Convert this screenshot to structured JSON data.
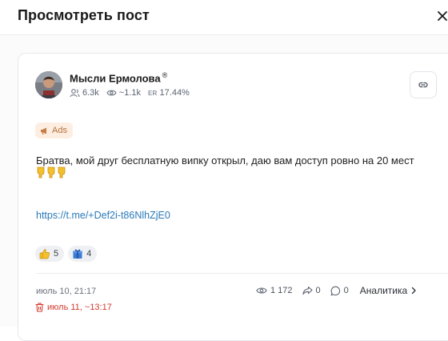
{
  "header": {
    "title": "Просмотреть пост"
  },
  "channel": {
    "name": "Мысли Ермолова",
    "reg_mark": "®",
    "subscribers": "6.3k",
    "views": "~1.1k",
    "er_label": "ER",
    "er_value": "17.44%"
  },
  "post": {
    "badge_label": "Ads",
    "text": "Братва, мой друг бесплатную випку открыл, даю вам доступ ровно на 20 мест",
    "link": "https://t.me/+Def2i-t86NlhZjE0",
    "reactions": [
      {
        "icon": "thumbs-up-icon",
        "count": "5"
      },
      {
        "icon": "gift-box-icon",
        "count": "4"
      }
    ]
  },
  "footer": {
    "published": "июль 10, 21:17",
    "deleted": "июль 11, ~13:17",
    "views": "1 172",
    "shares": "0",
    "comments": "0",
    "analytics_label": "Аналитика"
  },
  "colors": {
    "accent_link": "#2a7ab8",
    "delete_red": "#d33a2c",
    "ads_bg": "#fdeee1"
  }
}
